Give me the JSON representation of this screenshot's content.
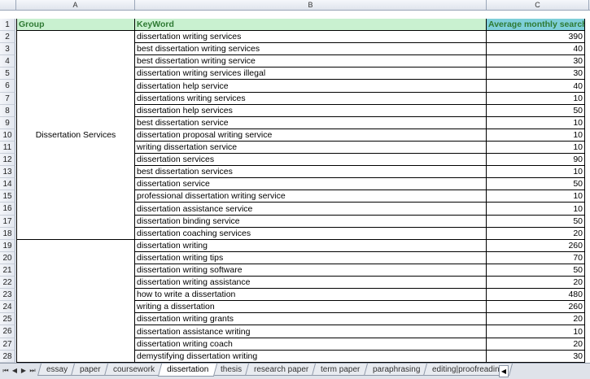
{
  "columns": [
    "A",
    "B",
    "C"
  ],
  "header": {
    "row": "1",
    "group": "Group",
    "keyword": "KeyWord",
    "search": "Average monthly search"
  },
  "groups": [
    {
      "label": "Dissertation Services"
    },
    {
      "label": ""
    }
  ],
  "rows": [
    {
      "n": "2",
      "keyword": "dissertation writing services",
      "search": "390"
    },
    {
      "n": "3",
      "keyword": "best dissertation writing services",
      "search": "40"
    },
    {
      "n": "4",
      "keyword": "best dissertation writing service",
      "search": "30"
    },
    {
      "n": "5",
      "keyword": "dissertation writing services illegal",
      "search": "30"
    },
    {
      "n": "6",
      "keyword": "dissertation help service",
      "search": "40"
    },
    {
      "n": "7",
      "keyword": "dissertations writing services",
      "search": "10"
    },
    {
      "n": "8",
      "keyword": "dissertation help services",
      "search": "50"
    },
    {
      "n": "9",
      "keyword": "best dissertation service",
      "search": "10"
    },
    {
      "n": "10",
      "keyword": "dissertation proposal writing service",
      "search": "10"
    },
    {
      "n": "11",
      "keyword": "writing dissertation service",
      "search": "10"
    },
    {
      "n": "12",
      "keyword": "dissertation services",
      "search": "90"
    },
    {
      "n": "13",
      "keyword": "best dissertation services",
      "search": "10"
    },
    {
      "n": "14",
      "keyword": "dissertation service",
      "search": "50"
    },
    {
      "n": "15",
      "keyword": "professional dissertation writing service",
      "search": "10"
    },
    {
      "n": "16",
      "keyword": "dissertation assistance service",
      "search": "10"
    },
    {
      "n": "17",
      "keyword": "dissertation binding service",
      "search": "50"
    },
    {
      "n": "18",
      "keyword": "dissertation coaching services",
      "search": "20"
    },
    {
      "n": "19",
      "keyword": "dissertation writing",
      "search": "260"
    },
    {
      "n": "20",
      "keyword": "dissertation writing tips",
      "search": "70"
    },
    {
      "n": "21",
      "keyword": "dissertation writing software",
      "search": "50"
    },
    {
      "n": "22",
      "keyword": "dissertation writing assistance",
      "search": "20"
    },
    {
      "n": "23",
      "keyword": "how to write a dissertation",
      "search": "480"
    },
    {
      "n": "24",
      "keyword": "writing a dissertation",
      "search": "260"
    },
    {
      "n": "25",
      "keyword": "dissertation writing grants",
      "search": "20"
    },
    {
      "n": "26",
      "keyword": "dissertation assistance writing",
      "search": "10"
    },
    {
      "n": "27",
      "keyword": "dissertation writing coach",
      "search": "20"
    },
    {
      "n": "28",
      "keyword": "demystifying dissertation writing",
      "search": "30"
    }
  ],
  "tabs": [
    "essay",
    "paper",
    "coursework",
    "dissertation",
    "thesis",
    "research paper",
    "term paper",
    "paraphrasing",
    "editing|proofreading"
  ],
  "active_tab": "dissertation",
  "nav_icons": [
    "first-sheet-icon",
    "prev-sheet-icon",
    "next-sheet-icon",
    "last-sheet-icon"
  ],
  "colors": {
    "header_bg": "#c9f1d0",
    "header_c_bg": "#7fcfd9",
    "header_text": "#2e7a33"
  }
}
